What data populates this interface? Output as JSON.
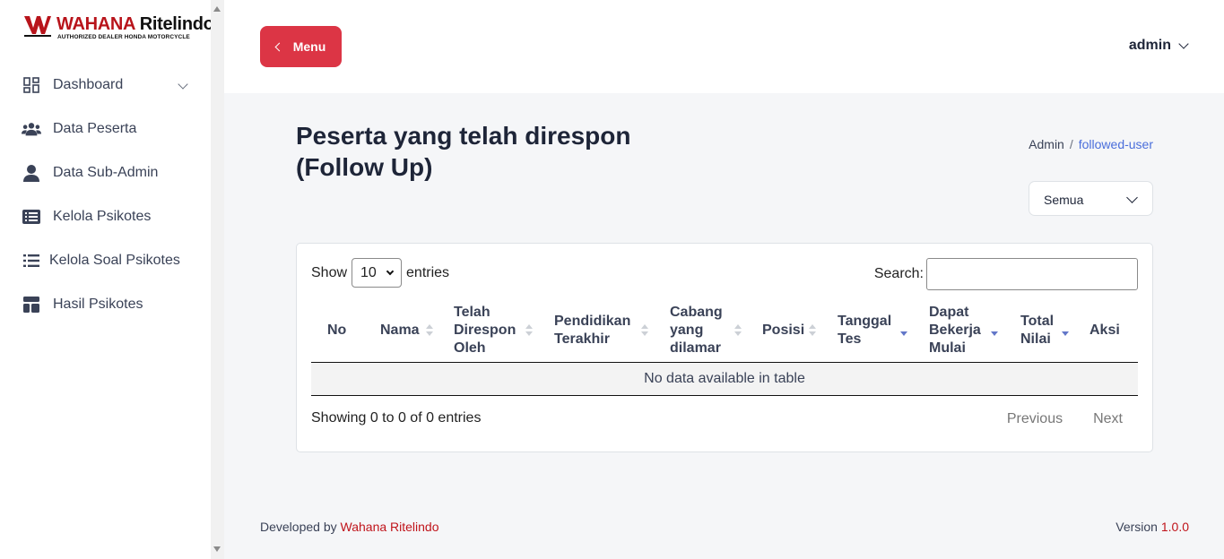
{
  "logo": {
    "brand_red": "WAHANA",
    "brand_dark": "Ritelindo",
    "tagline": "AUTHORIZED DEALER HONDA MOTORCYCLE"
  },
  "sidebar": {
    "items": [
      {
        "label": "Dashboard",
        "icon": "dashboard-grid-icon",
        "has_chevron": true
      },
      {
        "label": "Data Peserta",
        "icon": "users-group-icon"
      },
      {
        "label": "Data Sub-Admin",
        "icon": "user-icon"
      },
      {
        "label": "Kelola Psikotes",
        "icon": "list-box-icon"
      },
      {
        "label": "Kelola Soal Psikotes",
        "icon": "list-icon"
      },
      {
        "label": "Hasil Psikotes",
        "icon": "layout-icon"
      }
    ]
  },
  "header": {
    "menu_label": "Menu",
    "user_label": "admin"
  },
  "main": {
    "title": "Peserta yang telah direspon (Follow Up)",
    "breadcrumb": {
      "home": "Admin",
      "separator": "/",
      "current": "followed-user"
    },
    "filter_value": "Semua"
  },
  "table": {
    "length_prefix": "Show",
    "length_value": "10",
    "length_suffix": "entries",
    "search_label": "Search:",
    "columns": [
      {
        "label": "No"
      },
      {
        "label": "Nama"
      },
      {
        "label": "Telah Direspon Oleh"
      },
      {
        "label": "Pendidikan Terakhir"
      },
      {
        "label": "Cabang yang dilamar"
      },
      {
        "label": "Posisi"
      },
      {
        "label": "Tanggal Tes"
      },
      {
        "label": "Dapat Bekerja Mulai"
      },
      {
        "label": "Total Nilai"
      },
      {
        "label": "Aksi"
      }
    ],
    "empty_message": "No data available in table",
    "info": "Showing 0 to 0 of 0 entries",
    "previous_label": "Previous",
    "next_label": "Next"
  },
  "footer": {
    "developed_by": "Developed by",
    "company": "Wahana Ritelindo",
    "version_label": "Version",
    "version": "1.0.0"
  },
  "colors": {
    "accent_red": "#dc3545",
    "link_blue": "#4a6edb",
    "sort_active": "#6277c8"
  }
}
